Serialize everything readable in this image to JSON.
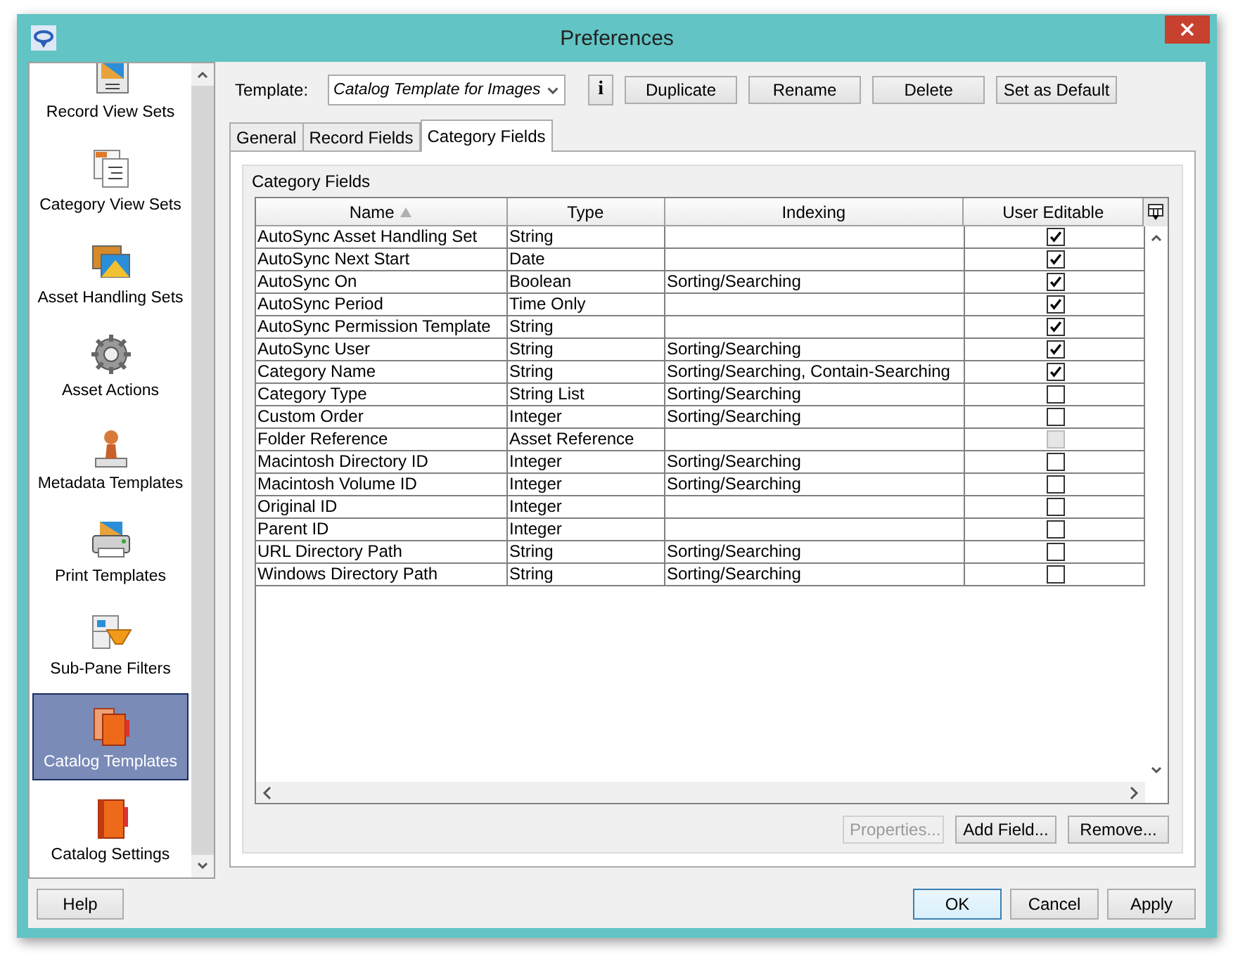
{
  "window": {
    "title": "Preferences"
  },
  "sidebar": {
    "items": [
      {
        "label": "Record View Sets",
        "selected": false
      },
      {
        "label": "Category View Sets",
        "selected": false
      },
      {
        "label": "Asset Handling Sets",
        "selected": false
      },
      {
        "label": "Asset Actions",
        "selected": false
      },
      {
        "label": "Metadata Templates",
        "selected": false
      },
      {
        "label": "Print Templates",
        "selected": false
      },
      {
        "label": "Sub-Pane Filters",
        "selected": false
      },
      {
        "label": "Catalog Templates",
        "selected": true
      },
      {
        "label": "Catalog Settings",
        "selected": false
      }
    ]
  },
  "template": {
    "label": "Template:",
    "value": "Catalog Template for Images",
    "info": "i",
    "buttons": [
      "Duplicate",
      "Rename",
      "Delete",
      "Set as Default"
    ]
  },
  "tabs": [
    {
      "label": "General",
      "selected": false
    },
    {
      "label": "Record Fields",
      "selected": false
    },
    {
      "label": "Category Fields",
      "selected": true
    }
  ],
  "group": {
    "title": "Category Fields"
  },
  "table": {
    "columns": [
      {
        "label": "Name",
        "sorted_ascending": true
      },
      {
        "label": "Type"
      },
      {
        "label": "Indexing"
      },
      {
        "label": "User Editable"
      }
    ],
    "rows": [
      {
        "name": "AutoSync Asset Handling Set",
        "type": "String",
        "user_editable": {
          "checked": true,
          "disabled": false
        }
      },
      {
        "name": "AutoSync Next Start",
        "type": "Date",
        "user_editable": {
          "checked": true,
          "disabled": false
        }
      },
      {
        "name": "AutoSync On",
        "type": "Boolean",
        "indexing": "Sorting/Searching",
        "user_editable": {
          "checked": true,
          "disabled": false
        }
      },
      {
        "name": "AutoSync Period",
        "type": "Time Only",
        "user_editable": {
          "checked": true,
          "disabled": false
        }
      },
      {
        "name": "AutoSync Permission Template",
        "type": "String",
        "user_editable": {
          "checked": true,
          "disabled": false
        }
      },
      {
        "name": "AutoSync User",
        "type": "String",
        "indexing": "Sorting/Searching",
        "user_editable": {
          "checked": true,
          "disabled": false
        }
      },
      {
        "name": "Category Name",
        "type": "String",
        "indexing": "Sorting/Searching, Contain-Searching",
        "user_editable": {
          "checked": true,
          "disabled": false
        }
      },
      {
        "name": "Category Type",
        "type": "String List",
        "indexing": "Sorting/Searching",
        "user_editable": {
          "checked": false,
          "disabled": false
        }
      },
      {
        "name": "Custom Order",
        "type": "Integer",
        "indexing": "Sorting/Searching",
        "user_editable": {
          "checked": false,
          "disabled": false
        }
      },
      {
        "name": "Folder Reference",
        "type": "Asset Reference",
        "user_editable": {
          "checked": false,
          "disabled": true
        }
      },
      {
        "name": "Macintosh Directory ID",
        "type": "Integer",
        "indexing": "Sorting/Searching",
        "user_editable": {
          "checked": false,
          "disabled": false
        }
      },
      {
        "name": "Macintosh Volume ID",
        "type": "Integer",
        "indexing": "Sorting/Searching",
        "user_editable": {
          "checked": false,
          "disabled": false
        }
      },
      {
        "name": "Original ID",
        "type": "Integer",
        "user_editable": {
          "checked": false,
          "disabled": false
        }
      },
      {
        "name": "Parent ID",
        "type": "Integer",
        "user_editable": {
          "checked": false,
          "disabled": false
        }
      },
      {
        "name": "URL Directory Path",
        "type": "String",
        "indexing": "Sorting/Searching",
        "user_editable": {
          "checked": false,
          "disabled": false
        }
      },
      {
        "name": "Windows Directory Path",
        "type": "String",
        "indexing": "Sorting/Searching",
        "user_editable": {
          "checked": false,
          "disabled": false
        }
      }
    ]
  },
  "table_buttons": [
    {
      "label": "Properties...",
      "disabled": true
    },
    {
      "label": "Add Field...",
      "disabled": false
    },
    {
      "label": "Remove...",
      "disabled": false
    }
  ],
  "help_button": "Help",
  "dialog_buttons": [
    {
      "label": "OK",
      "focused": true
    },
    {
      "label": "Cancel",
      "focused": false
    },
    {
      "label": "Apply",
      "focused": false
    }
  ]
}
